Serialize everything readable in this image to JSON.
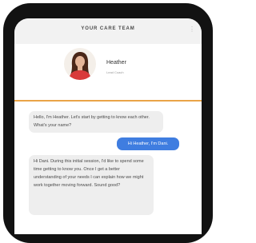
{
  "header": {
    "title": "YOUR CARE TEAM",
    "menu_icon": "more-vertical-icon",
    "menu_glyph": "⋮"
  },
  "coach": {
    "name": "Heather",
    "role": "Lead Coach"
  },
  "colors": {
    "accent": "#e9a447",
    "outgoing_bubble": "#3f7de0",
    "incoming_bubble": "#eeeeee"
  },
  "messages": [
    {
      "from": "coach",
      "text": "Hello, I'm Heather. Let's start by getting to know each other. What's your name?"
    },
    {
      "from": "user",
      "text": "Hi Heather, I'm Dani."
    },
    {
      "from": "coach",
      "text": "Hi Dani. During this initial session, I'd like to spend some time getting to know you. Once I get a better understanding of your needs I can explain how we might work together moving forward. Sound good?"
    }
  ]
}
